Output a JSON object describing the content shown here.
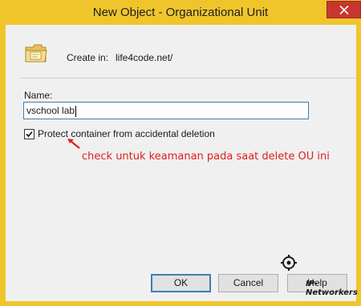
{
  "window": {
    "title": "New Object - Organizational Unit"
  },
  "header": {
    "create_in_label": "Create in:",
    "create_in_path": "life4code.net/"
  },
  "form": {
    "name_label": "Name:",
    "name_value": "vschool lab",
    "protect_label": "Protect container from accidental deletion",
    "protect_checked": true
  },
  "annotation": {
    "text": "check untuk keamanan pada saat delete OU ini",
    "color": "#e02020"
  },
  "buttons": {
    "ok": "OK",
    "cancel": "Cancel",
    "help": "Help"
  },
  "watermark": {
    "text": "IP-Networkers"
  },
  "icons": {
    "folder": "organizational-unit-folder-icon",
    "close": "close-icon",
    "check": "checkmark-icon",
    "arrow": "red-arrow-icon"
  },
  "colors": {
    "titlebar": "#f0c52c",
    "close_button": "#c7372f",
    "client": "#f0f0f0",
    "focus_border": "#3c7fb1"
  }
}
